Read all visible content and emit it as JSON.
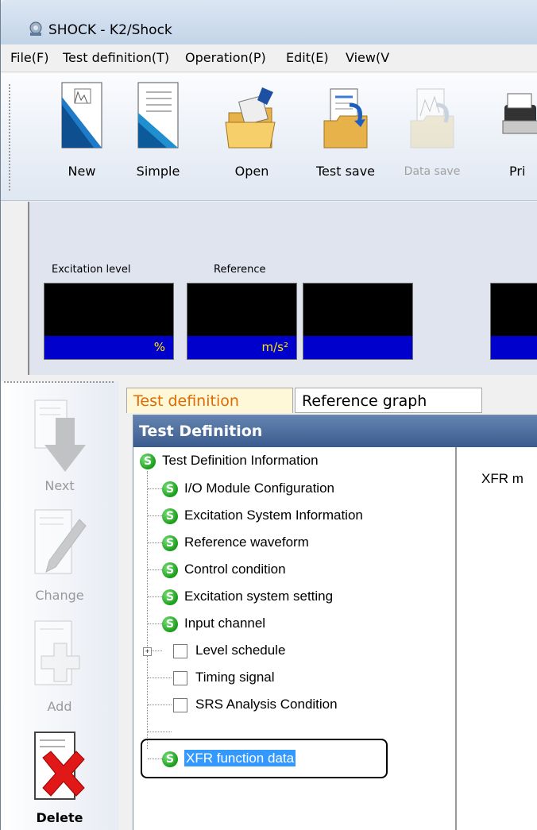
{
  "window": {
    "title": "SHOCK - K2/Shock"
  },
  "menu": [
    "File(F)",
    "Test definition(T)",
    "Operation(P)",
    "Edit(E)",
    "View(V"
  ],
  "toolbar": {
    "buttons": [
      {
        "label": "New",
        "icon": "new-document-icon",
        "enabled": true
      },
      {
        "label": "Simple",
        "icon": "simple-document-icon",
        "enabled": true
      },
      {
        "label": "Open",
        "icon": "open-folder-icon",
        "enabled": true
      },
      {
        "label": "Test save",
        "icon": "test-save-icon",
        "enabled": true
      },
      {
        "label": "Data save",
        "icon": "data-save-icon",
        "enabled": false
      },
      {
        "label": "Pri",
        "icon": "print-icon",
        "enabled": true
      }
    ]
  },
  "monitor": {
    "labels": {
      "excitation_level": "Excitation level",
      "reference": "Reference"
    },
    "units": {
      "excitation_level": "%",
      "reference": "m/s²"
    }
  },
  "sidebar": {
    "buttons": [
      {
        "label": "Next",
        "icon": "down-arrow-icon",
        "enabled": false
      },
      {
        "label": "Change",
        "icon": "pencil-edit-icon",
        "enabled": false
      },
      {
        "label": "Add",
        "icon": "plus-add-icon",
        "enabled": false
      },
      {
        "label": "Delete",
        "icon": "red-x-delete-icon",
        "enabled": true
      }
    ]
  },
  "tabs": [
    {
      "label": "Test definition",
      "active": true
    },
    {
      "label": "Reference graph",
      "active": false
    }
  ],
  "panel": {
    "header": "Test Definition",
    "tree": {
      "root": "Test Definition Information",
      "children": [
        {
          "label": "I/O Module Configuration",
          "state": "set"
        },
        {
          "label": "Excitation System Information",
          "state": "set"
        },
        {
          "label": "Reference waveform",
          "state": "set"
        },
        {
          "label": "Control condition",
          "state": "set"
        },
        {
          "label": "Excitation system setting",
          "state": "set"
        },
        {
          "label": "Input channel",
          "state": "set",
          "expandable": true
        },
        {
          "label": "Level schedule",
          "state": "unset"
        },
        {
          "label": "Timing signal",
          "state": "unset"
        },
        {
          "label": "SRS Analysis Condition",
          "state": "unset"
        },
        {
          "label": "XFR function data",
          "state": "set",
          "selected": true
        }
      ]
    },
    "detail_text": "XFR m"
  },
  "colors": {
    "status_set": "#2aa52a",
    "selection": "#3399ff",
    "header": "#4a6a9c",
    "active_tab_text": "#e06a00"
  }
}
